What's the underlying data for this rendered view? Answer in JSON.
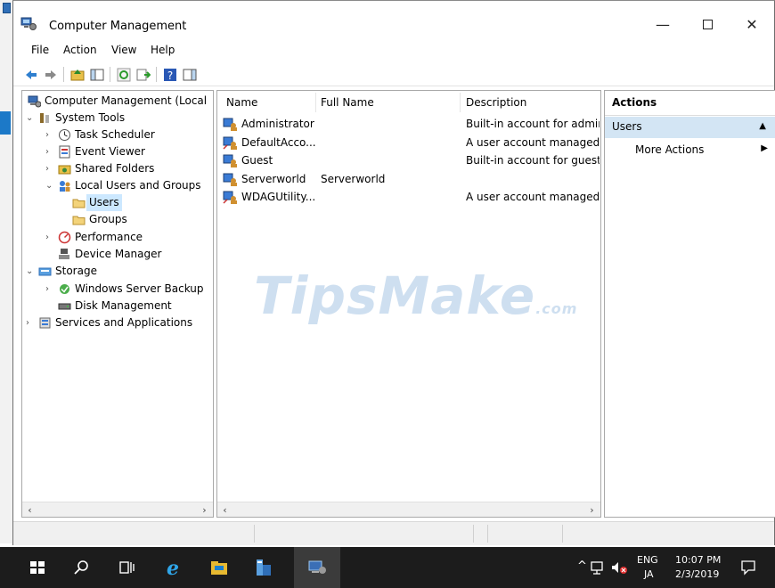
{
  "window": {
    "title": "Computer Management",
    "min_glyph": "—",
    "close_glyph": "✕"
  },
  "menu": [
    "File",
    "Action",
    "View",
    "Help"
  ],
  "tree": {
    "items": [
      {
        "label": "Computer Management (Local",
        "chev": "",
        "icon": "computer-management-icon"
      },
      {
        "label": "System Tools",
        "chev": "⌄",
        "icon": "system-tools-icon"
      },
      {
        "label": "Task Scheduler",
        "chev": "›",
        "icon": "clock-icon"
      },
      {
        "label": "Event Viewer",
        "chev": "›",
        "icon": "event-viewer-icon"
      },
      {
        "label": "Shared Folders",
        "chev": "›",
        "icon": "shared-folder-icon"
      },
      {
        "label": "Local Users and Groups",
        "chev": "⌄",
        "icon": "users-groups-icon"
      },
      {
        "label": "Users",
        "chev": "",
        "icon": "folder-icon"
      },
      {
        "label": "Groups",
        "chev": "",
        "icon": "folder-icon"
      },
      {
        "label": "Performance",
        "chev": "›",
        "icon": "performance-icon"
      },
      {
        "label": "Device Manager",
        "chev": "",
        "icon": "device-manager-icon"
      },
      {
        "label": "Storage",
        "chev": "⌄",
        "icon": "storage-icon"
      },
      {
        "label": "Windows Server Backup",
        "chev": "›",
        "icon": "backup-icon"
      },
      {
        "label": "Disk Management",
        "chev": "",
        "icon": "disk-icon"
      },
      {
        "label": "Services and Applications",
        "chev": "›",
        "icon": "services-icon"
      }
    ]
  },
  "list": {
    "columns": [
      "Name",
      "Full Name",
      "Description"
    ],
    "rows": [
      {
        "name": "Administrator",
        "full_name": "",
        "description": "Built-in account for admir"
      },
      {
        "name": "DefaultAcco...",
        "full_name": "",
        "description": "A user account managed l"
      },
      {
        "name": "Guest",
        "full_name": "",
        "description": "Built-in account for guest"
      },
      {
        "name": "Serverworld",
        "full_name": "Serverworld",
        "description": ""
      },
      {
        "name": "WDAGUtility...",
        "full_name": "",
        "description": "A user account managed a"
      }
    ]
  },
  "actions": {
    "header": "Actions",
    "section": "Users",
    "more": "More Actions"
  },
  "watermark": {
    "main": "TipsMake",
    "suffix": ".com"
  },
  "taskbar": {
    "lang_top": "ENG",
    "lang_bottom": "JA",
    "time": "10:07 PM",
    "date": "2/3/2019"
  },
  "colors": {
    "selection": "#cce8ff",
    "actions_highlight": "#d3e5f4",
    "taskbar": "#1c1c1c"
  }
}
